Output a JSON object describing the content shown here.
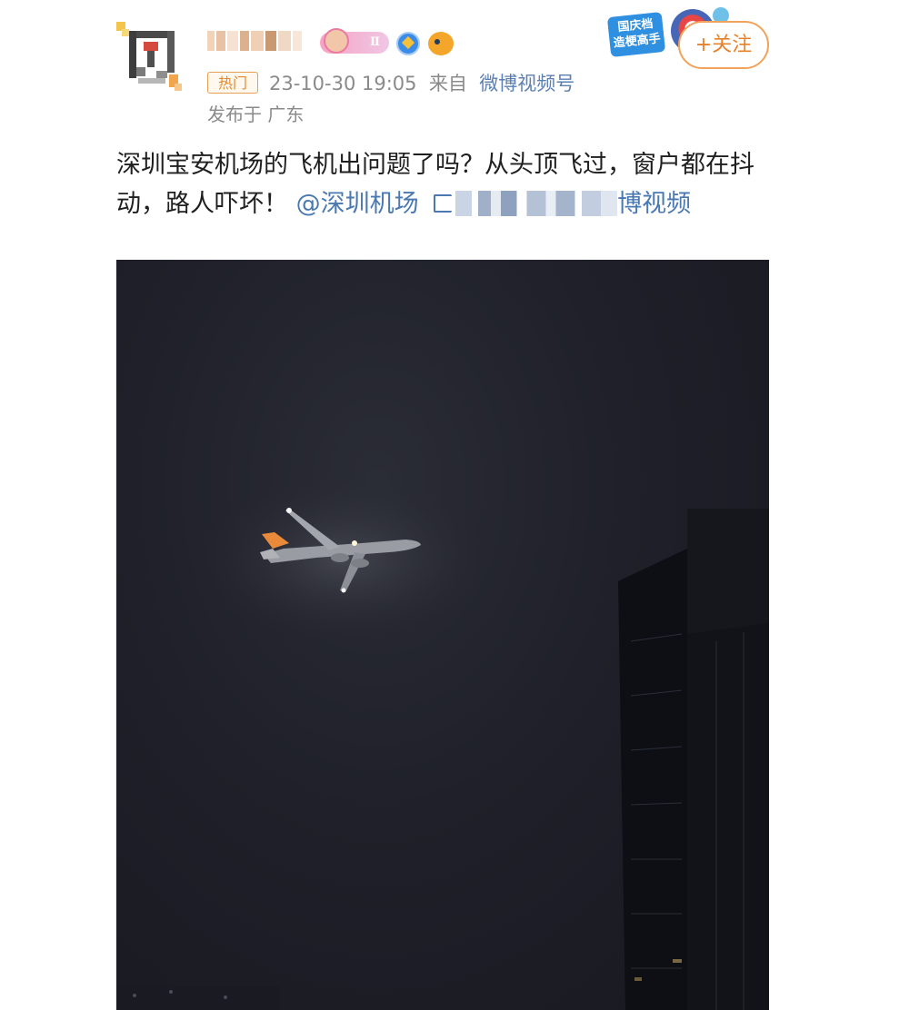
{
  "header": {
    "level_badge": "Ⅱ",
    "hot_tag": "热门",
    "datetime": "23-10-30 19:05",
    "from_label": "来自",
    "source": "微博视频号",
    "location": "发布于 广东",
    "event_badge": [
      "国庆档",
      "造梗高手"
    ],
    "follow_label": "+关注"
  },
  "post": {
    "text": "深圳宝安机场的飞机出问题了吗？从头顶飞过，窗户都在抖动，路人吓坏！",
    "mention": "@深圳机场",
    "link_tail": "博视频"
  },
  "colors": {
    "accent_orange": "#e8822a",
    "link_blue": "#4a78b0",
    "meta_gray": "#8a8a8a"
  },
  "icons": [
    "avatar",
    "level-badge-icon",
    "verified-icon",
    "fish-icon",
    "link-icon",
    "event-mascot-icon"
  ]
}
